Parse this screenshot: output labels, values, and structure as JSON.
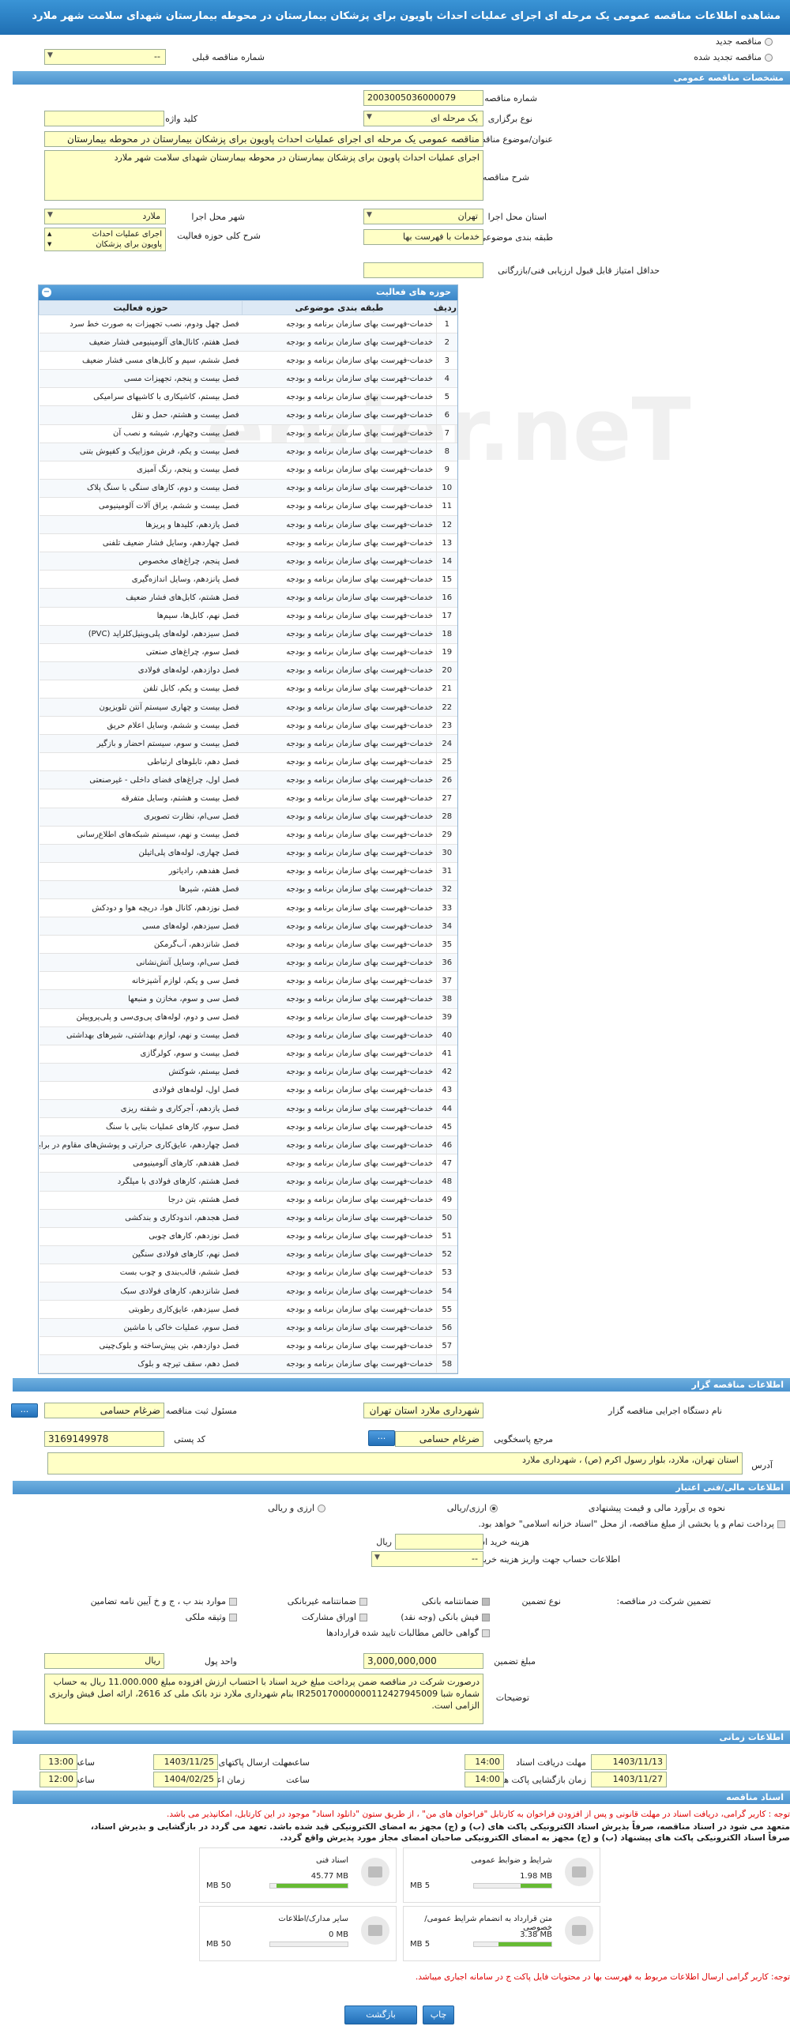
{
  "header": {
    "title": "مشاهده اطلاعات مناقصه عمومی یک مرحله ای اجرای عملیات احداث پاویون برای پزشکان بیمارستان در محوطه بیمارستان شهدای سلامت شهر ملارد"
  },
  "options": {
    "new_tender": "مناقصه جدید",
    "renew_tender": "مناقصه تجدید شده",
    "prev_number_label": "شماره مناقصه قبلی",
    "prev_number_value": "--"
  },
  "general": {
    "section": "مشخصات مناقصه عمومی",
    "number_label": "شماره مناقصه",
    "number_value": "2003005036000079",
    "type_label": "نوع برگزاری",
    "type_value": "یک مرحله ای",
    "keyword_label": "کلید واژه",
    "title_label": "عنوان/موضوع مناقصه",
    "title_value": "مناقصه عمومی یک مرحله ای اجرای عملیات احداث پاویون برای پزشکان بیمارستان در محوطه بیمارستان",
    "desc_label": "شرح مناقصه",
    "desc_value": "اجرای عملیات احداث پاویون برای پزشکان بیمارستان در محوطه بیمارستان شهدای سلامت شهر ملارد",
    "province_label": "استان محل اجرا",
    "province_value": "تهران",
    "city_label": "شهر محل اجرا",
    "city_value": "ملارد",
    "category_label": "طبقه بندی موضوعی",
    "category_value": "خدمات با فهرست بها",
    "scope_label": "شرح کلی حوزه فعالیت",
    "scope_items": [
      "اجرای عملیات احداث",
      "پاویون برای پزشکان"
    ],
    "min_score_label": "حداقل امتیاز قابل قبول ارزیابی فنی/بازرگانی"
  },
  "activity": {
    "title": "حوزه های فعالیت",
    "col_num": "ردیف",
    "col_cat": "طبقه بندی موضوعی",
    "col_field": "حوزه فعالیت",
    "cat": "خدمات-فهرست بهای سازمان برنامه و بودجه",
    "rows": [
      "فصل چهل ودوم، نصب تجهیزات به صورت خط سرد",
      "فصل هفتم، کانال‌های آلومینیومی فشار ضعیف",
      "فصل ششم، سیم و کابل‌های مسی فشار ضعیف",
      "فصل بیست و پنجم، تجهیزات مسی",
      "فصل بیستم، کاشیکاری با کاشیهای سرامیکی",
      "فصل بیست و هشتم، حمل و نقل",
      "فصل بیست وچهارم، شیشه و نصب آن",
      "فصل بیست و یکم، فرش موزاییک و کفپوش بتنی",
      "فصل بیست و پنجم، رنگ آمیزی",
      "فصل بیست و دوم، کارهای سنگی با سنگ پلاک",
      "فصل بیست و ششم، یراق آلات آلومینیومی",
      "فصل یازدهم، کلیدها و پریزها",
      "فصل چهاردهم، وسایل فشار ضعیف تلفنی",
      "فصل پنجم، چراغ‌های مخصوص",
      "فصل پانزدهم، وسایل اندازه‌گیری",
      "فصل هشتم، کابل‌های فشار ضعیف",
      "فصل نهم، کابل‌ها، سیم‌ها",
      "فصل سیزدهم، لوله‌های پلی‌وینیل‌کلراید (PVC)",
      "فصل سوم، چراغ‌های صنعتی",
      "فصل دوازدهم، لوله‌های فولادی",
      "فصل بیست و یکم، کابل تلفن",
      "فصل بیست و چهاری سیستم آنتن تلویزیون",
      "فصل بیست و ششم، وسایل اعلام حریق",
      "فصل بیست و سوم، سیستم احضار و بازگیر",
      "فصل دهم، تابلوهای ارتباطی",
      "فصل اول، چراغ‌های فضای داخلی - غیرصنعتی",
      "فصل بیست و هشتم، وسایل متفرقه",
      "فصل سی‌ام، نظارت تصویری",
      "فصل بیست و نهم، سیستم شبکه‌های اطلاع‌رسانی",
      "فصل چهاری، لوله‌های پلی‌اتیلن",
      "فصل هفدهم، رادیاتور",
      "فصل هفتم، شیرها",
      "فصل نوزدهم، کانال هوا، دریچه هوا و دودکش",
      "فصل سیزدهم، لوله‌های مسی",
      "فصل شانزدهم، آب‌گرمکن",
      "فصل سی‌ام، وسایل آتش‌نشانی",
      "فصل سی و یکم، لوازم آشپزخانه",
      "فصل سی و سوم، مخازن و منبعها",
      "فصل سی و دوم، لوله‌های پی‌وی‌سی و پلی‌پروپیلن",
      "فصل بیست و نهم، لوازم بهداشتی، شیرهای بهداشتی",
      "فصل بیست و سوم، کولرگازی",
      "فصل بیستم، شوکتش",
      "فصل اول، لوله‌های فولادی",
      "فصل یازدهم، آجرکاری و شفته ریزی",
      "فصل سوم، کارهای عملیات بنایی با سنگ",
      "فصل چهاردهم، عایق‌کاری حرارتی و پوشش‌های مقاوم در برابر آتش",
      "فصل هفدهم، کارهای آلومینیومی",
      "فصل هشتم، کارهای فولادی با میلگرد",
      "فصل هشتم، بتن درجا",
      "فصل هجدهم، اندودکاری و بندکشی",
      "فصل نوزدهم، کارهای چوبی",
      "فصل نهم، کارهای فولادی سنگین",
      "فصل ششم، قالب‌بندی و چوب بست",
      "فصل شانزدهم، کارهای فولادی سبک",
      "فصل سیزدهم، عایق‌کاری رطوبتی",
      "فصل سوم، عملیات خاکی با ماشین",
      "فصل دوازدهم، بتن پیش‌ساخته و بلوک‌چینی",
      "فصل دهم، سقف تیرچه و بلوک"
    ]
  },
  "holder": {
    "section": "اطلاعات مناقصه گزار",
    "org_label": "نام دستگاه اجرایی مناقصه گزار",
    "org_value": "شهرداری ملارد استان تهران",
    "resp_label": "مسئول ثبت مناقصه",
    "resp_value": "ضرغام حسامی",
    "ref_label": "مرجع پاسخگویی",
    "ref_value": "ضرغام حسامی",
    "postal_label": "کد پستی",
    "postal_value": "3169149978",
    "address_label": "آدرس",
    "address_value": "استان تهران، ملارد، بلوار رسول اکرم (ص) ، شهرداری ملارد",
    "more": "..."
  },
  "finance": {
    "section": "اطلاعات مالی/فنی اعتبار",
    "estimate_label": "نحوه ی برآورد مالی و قیمت پیشنهادی",
    "opt_rial": "ارزی/ریالی",
    "opt_currency": "ارزی و ریالی",
    "payment_note": "پرداخت تمام و یا بخشی از مبلغ مناقصه، از محل \"اسناد خزانه اسلامی\" خواهد بود.",
    "doc_fee_label": "هزینه خرید اسناد",
    "doc_fee_unit": "ریال",
    "account_label": "اطلاعات حساب جهت واریز هزینه خرید اسناد",
    "account_value": "--",
    "guarantee_label": "تضمین شرکت در مناقصه:",
    "guarantee_type_label": "نوع تضمین",
    "g_bank": "ضمانتنامه بانکی",
    "g_cash": "فیش بانکی (وجه نقد)",
    "g_claims": "گواهی خالص مطالبات تایید شده قراردادها",
    "g_nonbank": "ضمانتنامه غیربانکی",
    "g_bonds": "اوراق مشارکت",
    "g_items": "موارد بند ب ، ج و خ آیین نامه تضامین",
    "g_property": "وثیقه ملکی",
    "amount_label": "مبلغ تضمین",
    "amount_value": "3,000,000,000",
    "unit_label": "واحد پول",
    "unit_value": "ریال",
    "notes_label": "توضیحات",
    "notes_value": "درصورت شرکت در مناقصه ضمن پرداخت مبلغ خرید اسناد با احتساب ارزش افزوده مبلغ 11.000.000 ریال به حساب شماره شبا IR250170000000112427945009 بنام شهرداری ملارد نزد بانک ملی کد 2616، ارائه اصل فیش واریزی الزامی است."
  },
  "timing": {
    "section": "اطلاعات زمانی",
    "receive_label": "مهلت دریافت اسناد",
    "receive_date": "1403/11/13",
    "receive_time": "14:00",
    "submit_label": "مهلت ارسال پاکتهای پیشنهاد",
    "submit_date": "1403/11/25",
    "submit_time": "13:00",
    "open_label": "زمان بازگشایی پاکت ها",
    "open_date": "1403/11/27",
    "open_time": "14:00",
    "validity_label": "زمان اعتبار پیشنهاد",
    "validity_date": "1404/02/25",
    "validity_time": "12:00",
    "time_label": "ساعت"
  },
  "docs": {
    "section": "اسناد مناقصه",
    "note1": "توجه : کاربر گرامی، دریافت اسناد در مهلت قانونی و پس از افزودن فراخوان به کارتابل \"فراخوان های من\" ، از طریق ستون \"دانلود اسناد\" موجود در این کارتابل، امکانپذیر می باشد.",
    "note2": "متعهد می شود در اسناد مناقصه، صرفاً بذیرش اسناد الکترونیکی پاکت های (ب) و (ج) مجهز به امضای الکترونیکی قید شده باشد. تعهد می گردد در بازگشایی و بذیرش اسناد،",
    "note3": "صرفاً اسناد الکترونیکی پاکت های پیشنهاد (ب) و (ج) مجهز به امضای الکترونیکی صاحبان امضای مجاز مورد پذیرش واقع گردد.",
    "files": [
      {
        "name": "شرایط و ضوابط عمومی",
        "size": "1.98 MB",
        "max": "5 MB",
        "pct": 40
      },
      {
        "name": "اسناد فنی",
        "size": "45.77 MB",
        "max": "50 MB",
        "pct": 92
      },
      {
        "name": "متن قرارداد به انضمام شرایط عمومی/خصوصی",
        "size": "3.38 MB",
        "max": "5 MB",
        "pct": 68
      },
      {
        "name": "سایر مدارک/اطلاعات",
        "size": "0 MB",
        "max": "50 MB",
        "pct": 0
      }
    ],
    "note4": "توجه: کاربر گرامی ارسال اطلاعات مربوط به فهرست بها در محتویات فایل پاکت ج در سامانه اجباری میباشد."
  },
  "footer": {
    "print": "چاپ",
    "back": "بازگشت"
  },
  "watermark": "ender.neT"
}
